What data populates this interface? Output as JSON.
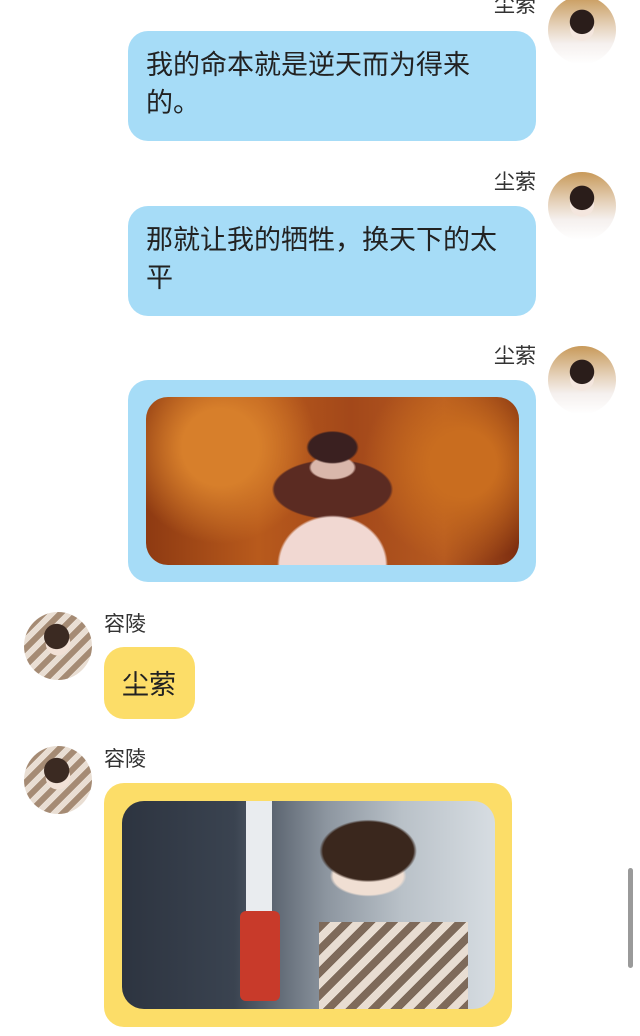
{
  "messages": [
    {
      "sender": "尘萦",
      "side": "right",
      "type": "text",
      "text": "我的命本就是逆天而为得来的。"
    },
    {
      "sender": "尘萦",
      "side": "right",
      "type": "text",
      "text": "那就让我的牺牲，换天下的太平"
    },
    {
      "sender": "尘萦",
      "side": "right",
      "type": "image",
      "text": ""
    },
    {
      "sender": "容陵",
      "side": "left",
      "type": "text",
      "text": "尘萦"
    },
    {
      "sender": "容陵",
      "side": "left",
      "type": "image",
      "text": ""
    }
  ],
  "colors": {
    "bubble_blue": "#a6dcf7",
    "bubble_yellow": "#fcdd68",
    "background": "#ffffff"
  }
}
